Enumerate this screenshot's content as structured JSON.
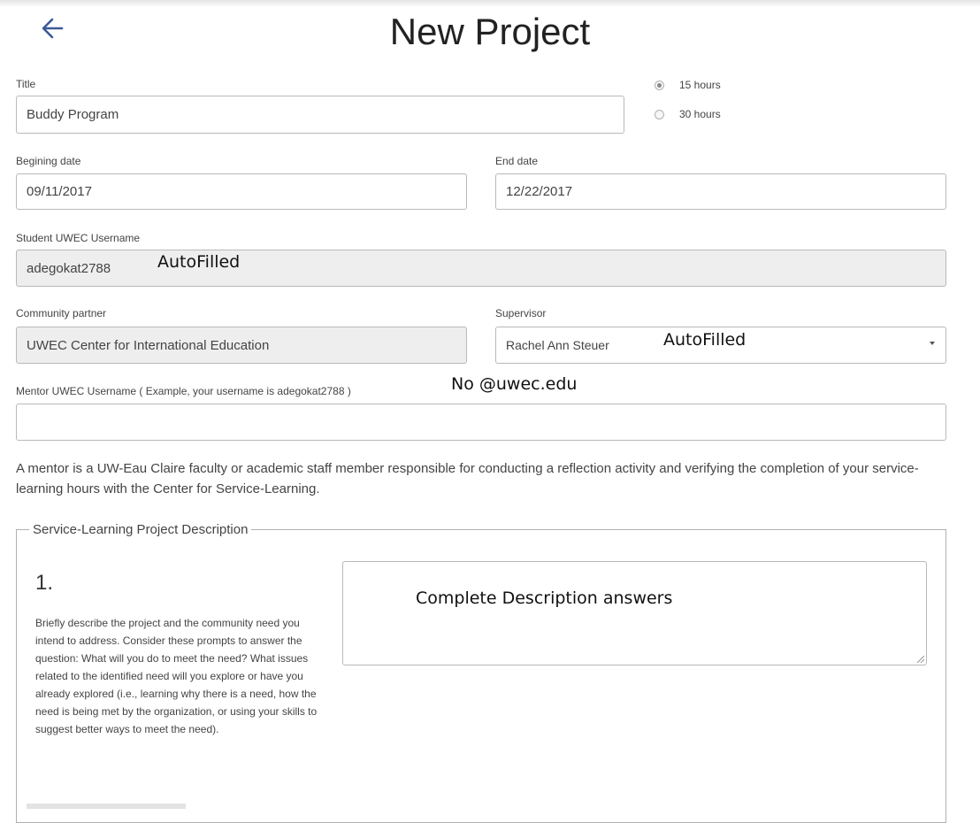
{
  "page": {
    "title": "New Project",
    "back_icon": "arrow-left-icon"
  },
  "colors": {
    "back_arrow": "#3b5998",
    "readonly_bg": "#eeeeee",
    "border": "#b9b9b9"
  },
  "form": {
    "title_label": "Title",
    "title_value": "Buddy Program",
    "hours_options": [
      {
        "label": "15 hours",
        "selected": true
      },
      {
        "label": "30 hours",
        "selected": false
      }
    ],
    "begin_label": "Begining date",
    "begin_value": "09/11/2017",
    "end_label": "End date",
    "end_value": "12/22/2017",
    "student_label": "Student UWEC Username",
    "student_value": "adegokat2788",
    "partner_label": "Community partner",
    "partner_value": "UWEC Center for International Education",
    "supervisor_label": "Supervisor",
    "supervisor_value": "Rachel Ann Steuer",
    "mentor_label": "Mentor UWEC Username ( Example, your username is adegokat2788 )",
    "mentor_value": "",
    "mentor_note": "A mentor is a UW-Eau Claire faculty or academic staff member responsible for conducting a reflection activity and verifying the completion of your service-learning hours with the Center for Service-Learning."
  },
  "description": {
    "legend": "Service-Learning Project Description",
    "questions": [
      {
        "number": "1.",
        "text": "Briefly describe the project and the community need you intend to address. Consider these prompts to answer the question: What will you do to meet the need? What issues related to the identified need will you explore or have you already explored (i.e., learning why there is a need, how the need is being met by the organization, or using your skills to suggest better ways to meet the need).",
        "answer": ""
      }
    ]
  },
  "annotations": {
    "student_autofill": "AutoFilled",
    "supervisor_autofill": "AutoFilled",
    "mentor_hint": "No @uwec.edu",
    "description_hint": "Complete Description answers"
  }
}
